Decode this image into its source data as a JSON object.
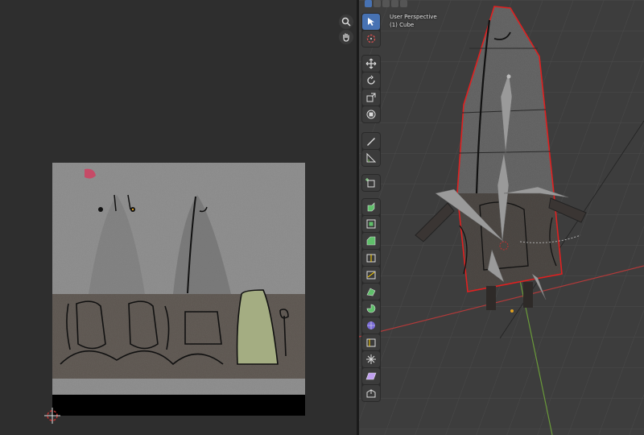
{
  "viewport": {
    "perspective_label": "User Perspective",
    "object_label": "(1) Cube"
  },
  "uv_nav_icons": [
    "zoom-icon",
    "hand-pan-icon"
  ],
  "toolbar_tools": [
    {
      "name": "select-box-tool",
      "group": 0,
      "active": true
    },
    {
      "name": "cursor-tool",
      "group": 0
    },
    {
      "name": "move-tool",
      "group": 1
    },
    {
      "name": "rotate-tool",
      "group": 1
    },
    {
      "name": "scale-tool",
      "group": 1
    },
    {
      "name": "transform-tool",
      "group": 1
    },
    {
      "name": "annotate-tool",
      "group": 2
    },
    {
      "name": "measure-tool",
      "group": 2
    },
    {
      "name": "add-cube-tool",
      "group": 3
    },
    {
      "name": "extrude-region-tool",
      "group": 4
    },
    {
      "name": "inset-faces-tool",
      "group": 4
    },
    {
      "name": "bevel-tool",
      "group": 4
    },
    {
      "name": "loop-cut-tool",
      "group": 4
    },
    {
      "name": "knife-tool",
      "group": 4
    },
    {
      "name": "poly-build-tool",
      "group": 4
    },
    {
      "name": "spin-tool",
      "group": 4
    },
    {
      "name": "smooth-tool",
      "group": 4
    },
    {
      "name": "edge-slide-tool",
      "group": 4
    },
    {
      "name": "shrink-fatten-tool",
      "group": 4
    },
    {
      "name": "shear-tool",
      "group": 4
    },
    {
      "name": "rip-region-tool",
      "group": 4
    }
  ],
  "colors": {
    "active_tool": "#4772b3",
    "selection_outline": "#e02020",
    "x_axis": "#b03a3a",
    "y_axis": "#6a9a3a"
  }
}
